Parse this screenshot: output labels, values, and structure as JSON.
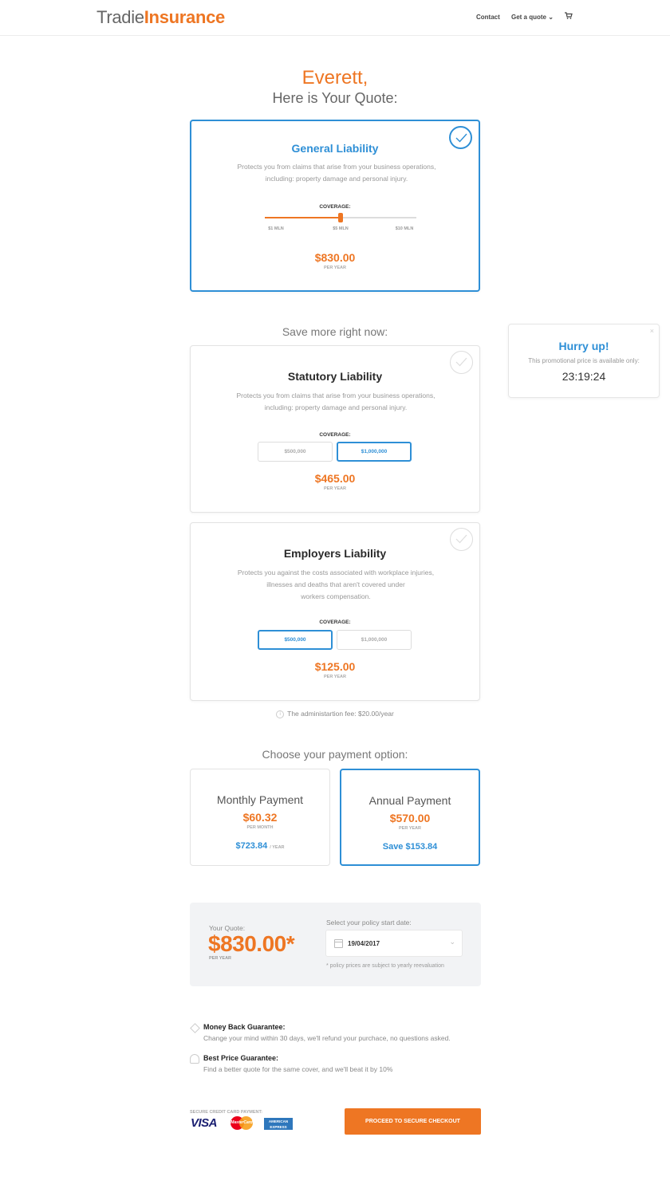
{
  "header": {
    "logo_part1": "Tradie",
    "logo_part2": "Insurance",
    "nav": {
      "contact": "Contact",
      "get_quote": "Get a quote ⌄",
      "cart_icon": "cart-icon"
    }
  },
  "greeting": {
    "name": "Everett,",
    "subtitle": "Here is Your Quote:"
  },
  "general_liability": {
    "title": "General Liability",
    "description": "Protects you from claims that arise from your business operations, including: property damage and personal injury.",
    "coverage_label": "COVERAGE:",
    "slider": {
      "ticks": [
        "$1 MLN",
        "$5 MLN",
        "$10 MLN"
      ],
      "selected": "$5 MLN",
      "fill_fraction": 0.5
    },
    "price": "$830.00",
    "per": "PER YEAR",
    "selected": true
  },
  "save_more_heading": "Save more right now:",
  "statutory_liability": {
    "title": "Statutory Liability",
    "description": "Protects you from claims that arise from your business operations, including: property damage and personal injury.",
    "coverage_label": "COVERAGE:",
    "options": [
      "$500,000",
      "$1,000,000"
    ],
    "selected_option": "$1,000,000",
    "price": "$465.00",
    "per": "PER YEAR"
  },
  "employers_liability": {
    "title": "Employers Liability",
    "description_lines": [
      "Protects you against the costs associated with workplace injuries,",
      "illnesses and deaths that aren't covered under",
      "workers compensation."
    ],
    "coverage_label": "COVERAGE:",
    "options": [
      "$500,000",
      "$1,000,000"
    ],
    "selected_option": "$500,000",
    "price": "$125.00",
    "per": "PER YEAR"
  },
  "admin_fee": "The administartion fee: $20.00/year",
  "popup": {
    "title": "Hurry up!",
    "text": "This promotional price is available only:",
    "timer": "23:19:24",
    "close": "×"
  },
  "payment": {
    "heading": "Choose your payment option:",
    "monthly": {
      "name": "Monthly Payment",
      "price": "$60.32",
      "per": "PER MONTH",
      "total": "$723.84",
      "total_per": "/ YEAR"
    },
    "annual": {
      "name": "Annual Payment",
      "price": "$570.00",
      "per": "PER YEAR",
      "save": "Save $153.84"
    },
    "selected": "annual"
  },
  "summary": {
    "label": "Your Quote:",
    "price": "$830.00*",
    "per": "PER YEAR",
    "date_label": "Select your policy start date:",
    "date_value": "19/04/2017",
    "note": "* policy prices are subject to yearly reevaluation"
  },
  "guarantees": [
    {
      "title": "Money Back Guarantee:",
      "text": "Change your mind within 30 days, we'll refund your purchace, no questions asked."
    },
    {
      "title": "Best Price Guarantee:",
      "text": "Find a better quote for the same cover, and we'll beat it by 10%"
    }
  ],
  "footer": {
    "secure_label": "SECURE CREDIT CARD PAYMENT:",
    "visa": "VISA",
    "mastercard": "MasterCard",
    "amex": [
      "AMERICAN",
      "EXPRESS"
    ],
    "cta": "PROCEED TO SECURE CHECKOUT"
  },
  "colors": {
    "accent": "#ee7623",
    "primary": "#2e8fd6"
  }
}
